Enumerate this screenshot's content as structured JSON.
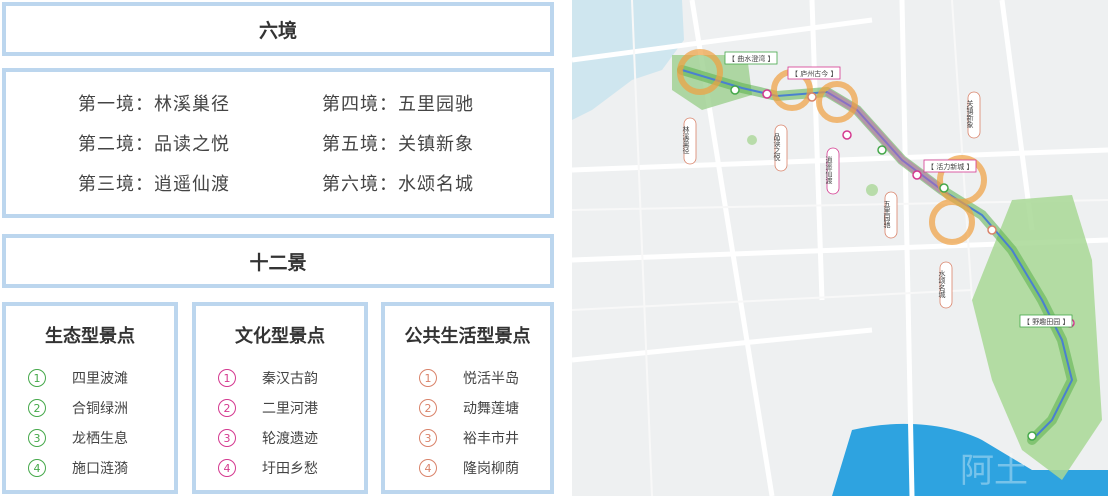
{
  "six_scenes": {
    "title": "六境",
    "items": [
      "第一境：林溪巢径",
      "第二境：品读之悦",
      "第三境：逍遥仙渡",
      "第四境：五里园驰",
      "第五境：关镇新象",
      "第六境：水颂名城"
    ]
  },
  "twelve_views": {
    "title": "十二景",
    "categories": [
      {
        "title": "生态型景点",
        "color": "#45a84a",
        "items": [
          {
            "num": "1",
            "label": "四里波滩"
          },
          {
            "num": "2",
            "label": "合铜绿洲"
          },
          {
            "num": "3",
            "label": "龙栖生息"
          },
          {
            "num": "4",
            "label": "施口涟漪"
          }
        ]
      },
      {
        "title": "文化型景点",
        "color": "#d4388f",
        "items": [
          {
            "num": "1",
            "label": "秦汉古韵"
          },
          {
            "num": "2",
            "label": "二里河港"
          },
          {
            "num": "3",
            "label": "轮渡遗迹"
          },
          {
            "num": "4",
            "label": "圩田乡愁"
          }
        ]
      },
      {
        "title": "公共生活型景点",
        "color": "#d9836a",
        "items": [
          {
            "num": "1",
            "label": "悦活半岛"
          },
          {
            "num": "2",
            "label": "动舞莲塘"
          },
          {
            "num": "3",
            "label": "裕丰市井"
          },
          {
            "num": "4",
            "label": "隆岗柳荫"
          }
        ]
      }
    ]
  },
  "map": {
    "top_labels": [
      "【 曲水澄湾 】",
      "【 庐州古今 】",
      "【 活力新城 】",
      "【 野趣田园 】"
    ],
    "vertical_labels": [
      "林溪巢径",
      "品读之悦",
      "逍遥仙渡",
      "五里园驰",
      "水颂名城",
      "关镇新象"
    ],
    "watermark": "阿土"
  }
}
